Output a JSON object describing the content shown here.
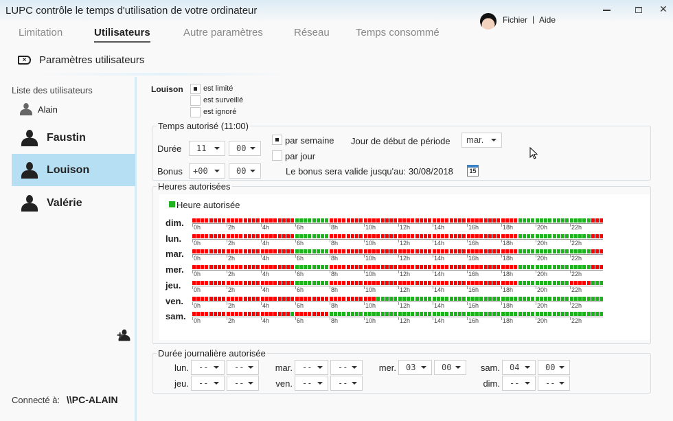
{
  "window": {
    "title": "LUPC contrôle le temps d'utilisation de votre ordinateur",
    "menu": [
      "Fichier",
      "Aide"
    ],
    "separator": "|"
  },
  "tabs": [
    {
      "label": "Limitation"
    },
    {
      "label": "Utilisateurs",
      "active": true
    },
    {
      "label": "Autre paramètres"
    },
    {
      "label": "Réseau"
    },
    {
      "label": "Temps consommé"
    }
  ],
  "section_title": "Paramètres utilisateurs",
  "sidebar": {
    "heading": "Liste des utilisateurs",
    "users": [
      {
        "name": "Alain"
      },
      {
        "name": "Faustin"
      },
      {
        "name": "Louison",
        "selected": true
      },
      {
        "name": "Valérie"
      }
    ],
    "connected_label": "Connecté à:",
    "connected_host": "\\\\PC-ALAIN"
  },
  "user": {
    "name": "Louison",
    "options": [
      {
        "label": "est limité",
        "checked": true
      },
      {
        "label": "est surveillé",
        "checked": false
      },
      {
        "label": "est ignoré",
        "checked": false
      }
    ]
  },
  "temps": {
    "legend": "Temps autorisé (11:00)",
    "duree_label": "Durée",
    "duree_h": "11",
    "duree_m": "00",
    "bonus_label": "Bonus",
    "bonus_h": "+00",
    "bonus_m": "00",
    "par_semaine": "par semaine",
    "par_semaine_checked": true,
    "par_jour": "par jour",
    "par_jour_checked": false,
    "jour_debut_label": "Jour de début de période",
    "jour_debut": "mar.",
    "bonus_valid": "Le bonus sera valide jusqu'au: 30/08/2018"
  },
  "heures": {
    "legend": "Heures autorisées",
    "key_label": "Heure autorisée",
    "allowed_color": "#1db31d",
    "denied_color": "#ff0000",
    "tick_labels": [
      "0h",
      "2h",
      "4h",
      "6h",
      "8h",
      "10h",
      "12h",
      "14h",
      "16h",
      "18h",
      "20h",
      "22h"
    ],
    "days": [
      {
        "label": "dim.",
        "allowed": [
          [
            6,
            8
          ],
          [
            19,
            23.25
          ]
        ]
      },
      {
        "label": "lun.",
        "allowed": [
          [
            6,
            8
          ],
          [
            19,
            23.25
          ]
        ]
      },
      {
        "label": "mar.",
        "allowed": [
          [
            6,
            8
          ],
          [
            19,
            23.25
          ]
        ]
      },
      {
        "label": "mer.",
        "allowed": [
          [
            6,
            8
          ],
          [
            19,
            23.25
          ]
        ]
      },
      {
        "label": "jeu.",
        "allowed": [
          [
            6,
            8
          ],
          [
            19,
            22
          ],
          [
            23.25,
            24
          ]
        ]
      },
      {
        "label": "ven.",
        "allowed": [
          [
            10.75,
            24
          ]
        ]
      },
      {
        "label": "sam.",
        "allowed": [
          [
            5.75,
            6
          ],
          [
            8,
            24
          ]
        ]
      }
    ]
  },
  "journaliere": {
    "legend": "Durée journalière autorisée",
    "days": [
      {
        "label": "lun.",
        "h": "--",
        "m": "--"
      },
      {
        "label": "jeu.",
        "h": "--",
        "m": "--"
      },
      {
        "label": "mar.",
        "h": "--",
        "m": "--"
      },
      {
        "label": "ven.",
        "h": "--",
        "m": "--"
      },
      {
        "label": "mer.",
        "h": "03",
        "m": "00"
      },
      {
        "label": "sam.",
        "h": "04",
        "m": "00"
      },
      {
        "label": "dim.",
        "h": "--",
        "m": "--"
      }
    ]
  },
  "calendar_icon_text": "15"
}
